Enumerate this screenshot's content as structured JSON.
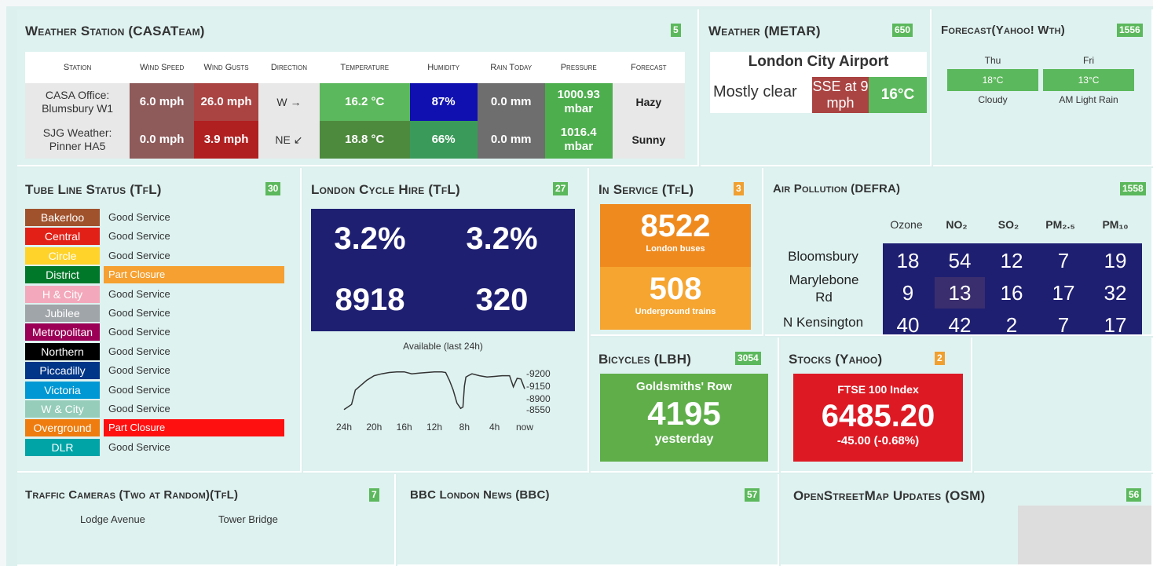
{
  "weather_station": {
    "title": "Weather Station (CASATeam)",
    "badge": "5",
    "headers": [
      "Station",
      "Wind Speed",
      "Wind Gusts",
      "Direction",
      "Temperature",
      "Humidity",
      "Rain Today",
      "Pressure",
      "Forecast"
    ],
    "rows": [
      {
        "station": "CASA Office: Blumsbury W1",
        "speed": "6.0 mph",
        "gusts": "26.0 mph",
        "direction": "W →",
        "temperature": "16.2 °C",
        "humidity": "87%",
        "rain": "0.0 mm",
        "pressure": "1000.93 mbar",
        "forecast": "Hazy"
      },
      {
        "station": "SJG Weather: Pinner HA5",
        "speed": "0.0 mph",
        "gusts": "3.9 mph",
        "direction": "NE ↙",
        "temperature": "18.8 °C",
        "humidity": "66%",
        "rain": "0.0 mm",
        "pressure": "1016.4 mbar",
        "forecast": "Sunny"
      }
    ],
    "colors": {
      "speed": "#8e5a5a",
      "gusts1": "#a94442",
      "gusts2": "#b02020",
      "temp1": "#5cb85c",
      "temp2": "#4e8a3e",
      "hum1": "#1010b0",
      "hum2": "#3a9a5a",
      "rain": "#6e6e6e",
      "press": "#4cae4c"
    }
  },
  "metar": {
    "title": "Weather (METAR)",
    "badge": "650",
    "airport": "London City Airport",
    "condition": "Mostly clear",
    "wind": "SSE at 9 mph",
    "temp": "16°C"
  },
  "forecast": {
    "title": "Forecast(Yahoo! Wth)",
    "badge": "1556",
    "days": [
      {
        "day": "Thu",
        "temp": "18°C",
        "desc": "Cloudy"
      },
      {
        "day": "Fri",
        "temp": "13°C",
        "desc": "AM Light Rain"
      }
    ]
  },
  "tube": {
    "title": "Tube Line Status (TfL)",
    "badge": "30",
    "lines": [
      {
        "name": "Bakerloo",
        "status": "Good Service",
        "color": "#a0522d",
        "state": "good"
      },
      {
        "name": "Central",
        "status": "Good Service",
        "color": "#e32017",
        "state": "good"
      },
      {
        "name": "Circle",
        "status": "Good Service",
        "color": "#ffd329",
        "state": "good"
      },
      {
        "name": "District",
        "status": "Part Closure",
        "color": "#00782a",
        "state": "part"
      },
      {
        "name": "H & City",
        "status": "Good Service",
        "color": "#f3a9bb",
        "state": "good"
      },
      {
        "name": "Jubilee",
        "status": "Good Service",
        "color": "#a0a5a9",
        "state": "good"
      },
      {
        "name": "Metropolitan",
        "status": "Good Service",
        "color": "#9b0056",
        "state": "good"
      },
      {
        "name": "Northern",
        "status": "Good Service",
        "color": "#000000",
        "state": "good"
      },
      {
        "name": "Piccadilly",
        "status": "Good Service",
        "color": "#003688",
        "state": "good"
      },
      {
        "name": "Victoria",
        "status": "Good Service",
        "color": "#0098d4",
        "state": "good"
      },
      {
        "name": "W & City",
        "status": "Good Service",
        "color": "#95cdba",
        "state": "good"
      },
      {
        "name": "Overground",
        "status": "Part Closure",
        "color": "#ee7c0e",
        "state": "red"
      },
      {
        "name": "DLR",
        "status": "Good Service",
        "color": "#00a4a7",
        "state": "good"
      }
    ]
  },
  "cycle": {
    "title": "London Cycle Hire (TfL)",
    "badge": "27",
    "pct1": "3.2%",
    "pct2": "3.2%",
    "num1": "8918",
    "num2": "320",
    "chart_label": "Available (last 24h)",
    "x_ticks": [
      "24h",
      "20h",
      "16h",
      "12h",
      "8h",
      "4h",
      "now"
    ],
    "y_ticks": [
      "-9200",
      "-9150",
      "-8900",
      "-8550"
    ]
  },
  "chart_data": {
    "type": "line",
    "title": "Available (last 24h)",
    "xlabel": "",
    "ylabel": "",
    "x_ticks": [
      "24h",
      "20h",
      "16h",
      "12h",
      "8h",
      "4h",
      "now"
    ],
    "y_ticks": [
      "-9200",
      "-9150",
      "-8900",
      "-8550"
    ],
    "x": [
      24,
      23,
      22.5,
      22,
      21,
      20,
      19,
      18,
      17,
      16,
      15,
      14,
      13,
      12,
      11,
      10.5,
      10,
      9.5,
      9,
      8.5,
      8.2,
      8,
      7.8,
      7.5,
      7,
      6,
      5,
      4,
      3,
      2,
      1.5,
      1,
      0.5,
      0
    ],
    "values": [
      8600,
      8680,
      8900,
      8950,
      9050,
      9120,
      9150,
      9170,
      9180,
      9180,
      9150,
      9160,
      9170,
      9180,
      9180,
      9170,
      9050,
      8900,
      8700,
      8620,
      8640,
      8960,
      9100,
      9120,
      9150,
      9120,
      9100,
      9110,
      9120,
      9120,
      8950,
      9080,
      9070,
      8920
    ]
  },
  "inservice": {
    "title": "In Service (TfL)",
    "badge": "3",
    "buses": "8522",
    "buses_label": "London buses",
    "trains": "508",
    "trains_label": "Underground trains"
  },
  "air": {
    "title": "Air Pollution (DEFRA)",
    "badge": "1558",
    "cols": [
      "Ozone",
      "NO₂",
      "SO₂",
      "PM₂.₅",
      "PM₁₀"
    ],
    "rows": [
      {
        "name": "Bloomsbury",
        "vals": [
          "18",
          "54",
          "12",
          "7",
          "19"
        ]
      },
      {
        "name": "Marylebone Rd",
        "vals": [
          "9",
          "13",
          "16",
          "17",
          "32"
        ]
      },
      {
        "name": "N Kensington",
        "vals": [
          "40",
          "42",
          "2",
          "7",
          "17"
        ]
      }
    ]
  },
  "bicycles": {
    "title": "Bicycles (LBH)",
    "badge": "3054",
    "place": "Goldsmiths' Row",
    "count": "4195",
    "when": "yesterday"
  },
  "stocks": {
    "title": "Stocks (Yahoo)",
    "badge": "2",
    "index": "FTSE 100 Index",
    "value": "6485.20",
    "change": "-45.00 (-0.68%)"
  },
  "cameras": {
    "title": "Traffic Cameras (Two at Random)(TfL)",
    "badge": "7",
    "cam1": "Lodge Avenue",
    "cam2": "Tower Bridge"
  },
  "bbc": {
    "title": "BBC London News (BBC)",
    "badge": "57"
  },
  "osm": {
    "title": "OpenStreetMap Updates (OSM)",
    "badge": "56"
  }
}
